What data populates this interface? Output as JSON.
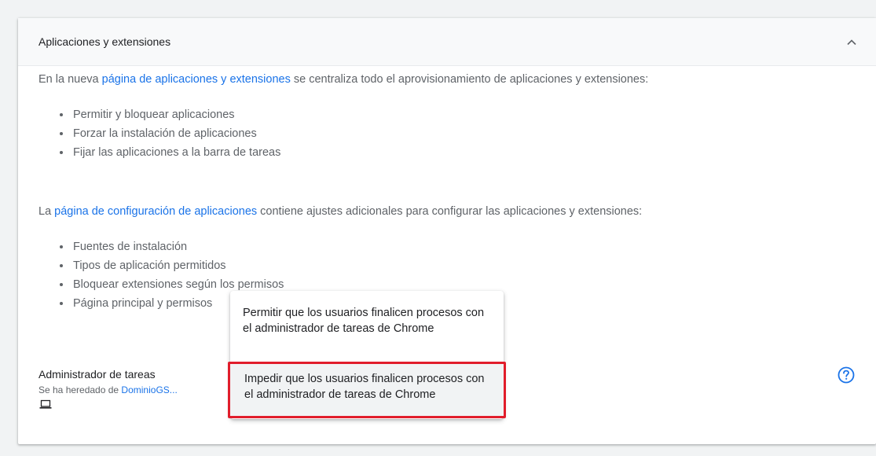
{
  "section": {
    "title": "Aplicaciones y extensiones",
    "collapse_icon": "chevron-up-icon"
  },
  "intro1": {
    "prefix": "En la nueva ",
    "link": "página de aplicaciones y extensiones",
    "suffix": " se centraliza todo el aprovisionamiento de aplicaciones y extensiones:"
  },
  "list1": [
    "Permitir y bloquear aplicaciones",
    "Forzar la instalación de aplicaciones",
    "Fijar las aplicaciones a la barra de tareas"
  ],
  "intro2": {
    "prefix": "La ",
    "link": "página de configuración de aplicaciones",
    "suffix": " contiene ajustes adicionales para configurar las aplicaciones y extensiones:"
  },
  "list2": [
    "Fuentes de instalación",
    "Tipos de aplicación permitidos",
    "Bloquear extensiones según los permisos",
    "Página principal y permisos"
  ],
  "setting": {
    "name": "Administrador de tareas",
    "inherited_prefix": "Se ha heredado de ",
    "inherited_link": "DominioGS...",
    "device_icon": "laptop-icon",
    "help_icon": "help-circle-icon"
  },
  "dropdown": {
    "options": [
      "Permitir que los usuarios finalicen procesos con el administrador de tareas de Chrome",
      "Impedir que los usuarios finalicen procesos con el administrador de tareas de Chrome"
    ],
    "highlighted_index": 1,
    "highlight_color": "#e11d2b"
  },
  "colors": {
    "link": "#1a73e8",
    "body_text": "#5f6368"
  }
}
